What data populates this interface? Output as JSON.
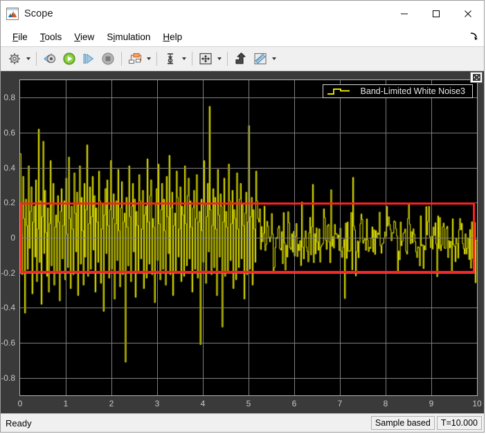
{
  "window": {
    "title": "Scope",
    "app_icon": "matlab-membrane-icon",
    "controls": [
      {
        "name": "minimize-button",
        "glyph": "minimize-icon"
      },
      {
        "name": "maximize-button",
        "glyph": "maximize-icon"
      },
      {
        "name": "close-button",
        "glyph": "close-icon"
      }
    ]
  },
  "menubar": {
    "items": [
      {
        "label": "File",
        "mnemonic": "F"
      },
      {
        "label": "Tools",
        "mnemonic": "T"
      },
      {
        "label": "View",
        "mnemonic": "V"
      },
      {
        "label": "Simulation",
        "mnemonic": "i"
      },
      {
        "label": "Help",
        "mnemonic": "H"
      }
    ],
    "corner_icon": "undock-arrow-icon"
  },
  "toolbar": {
    "buttons": [
      {
        "name": "configuration-properties-button",
        "icon": "gear-icon",
        "has_caret": true
      },
      {
        "name": "sim-rewind-button",
        "icon": "rewind-icon",
        "has_caret": false
      },
      {
        "name": "run-button",
        "icon": "play-icon",
        "has_caret": false
      },
      {
        "name": "step-forward-button",
        "icon": "step-forward-icon",
        "has_caret": false
      },
      {
        "name": "stop-button",
        "icon": "stop-icon",
        "has_caret": false
      },
      {
        "name": "signal-selection-button",
        "icon": "signal-blocks-icon",
        "has_caret": true
      },
      {
        "name": "cursor-measurements-button",
        "icon": "cursor-icon",
        "has_caret": true
      },
      {
        "name": "scale-axes-limits-button",
        "icon": "fit-to-view-icon",
        "has_caret": true
      },
      {
        "name": "highlight-signal-button",
        "icon": "highlight-arrow-icon",
        "has_caret": false
      },
      {
        "name": "measurements-button",
        "icon": "ruler-icon",
        "has_caret": true
      }
    ]
  },
  "plot": {
    "fit_button_icon": "expand-icon",
    "legend": {
      "label": "Band-Limited White Noise3",
      "glyph": "yellow-step-line-icon",
      "color": "#ffff00"
    },
    "bound_rect": {
      "color": "#ff2020",
      "y_top": 0.2,
      "y_bottom": -0.2,
      "x_left": 0.0,
      "x_right": 9.95
    }
  },
  "statusbar": {
    "ready_text": "Ready",
    "sample_mode": "Sample based",
    "time": "T=10.000"
  },
  "chart_data": {
    "type": "line",
    "title": "",
    "xlabel": "",
    "ylabel": "",
    "xlim": [
      0,
      10
    ],
    "ylim": [
      -0.9,
      0.9
    ],
    "xticks": [
      0,
      1,
      2,
      3,
      4,
      5,
      6,
      7,
      8,
      9,
      10
    ],
    "yticks": [
      -0.8,
      -0.6,
      -0.4,
      -0.2,
      0,
      0.2,
      0.4,
      0.6,
      0.8
    ],
    "ytick_labels": [
      "-0.8",
      "-0.6",
      "-0.4",
      "-0.2",
      "0",
      "0.2",
      "0.4",
      "0.6",
      "0.8"
    ],
    "xtick_labels": [
      "0",
      "1",
      "2",
      "3",
      "4",
      "5",
      "6",
      "7",
      "8",
      "9",
      "10"
    ],
    "grid": true,
    "background": "#000000",
    "grid_color": "#808080",
    "legend_position": "top-right",
    "series": [
      {
        "name": "Band-Limited White Noise3",
        "color": "#ffff00",
        "style": "stairs",
        "sample_count": 500,
        "x_start": 0,
        "x_end": 10,
        "description": "Band-limited white noise, sample-based, mean 0, values mostly within +/-0.25 with occasional excursions to +/-0.75",
        "values": [
          0.48,
          0.02,
          -0.21,
          0.35,
          0.11,
          -0.43,
          0.22,
          0.07,
          -0.18,
          0.41,
          -0.06,
          0.15,
          0.29,
          -0.32,
          0.09,
          0.18,
          -0.11,
          0.33,
          -0.25,
          0.05,
          0.62,
          -0.14,
          0.21,
          -0.38,
          0.12,
          0.55,
          -0.09,
          0.27,
          0.03,
          -0.22,
          0.17,
          -0.31,
          0.08,
          0.44,
          -0.16,
          0.19,
          0.31,
          -0.27,
          0.06,
          0.13,
          -0.19,
          0.24,
          0.09,
          -0.36,
          0.15,
          0.28,
          -0.12,
          0.07,
          0.21,
          -0.24,
          0.34,
          0.02,
          -0.17,
          0.46,
          0.11,
          -0.29,
          0.18,
          0.05,
          -0.21,
          0.37,
          0.14,
          -0.08,
          0.26,
          -0.33,
          0.19,
          0.41,
          -0.15,
          0.23,
          0.04,
          -0.27,
          0.31,
          -0.11,
          0.16,
          0.53,
          -0.22,
          0.08,
          0.29,
          -0.18,
          0.12,
          0.35,
          -0.07,
          0.24,
          -0.31,
          0.17,
          0.09,
          -0.14,
          0.38,
          0.21,
          -0.26,
          0.05,
          0.19,
          -0.42,
          0.13,
          0.28,
          -0.09,
          0.33,
          0.07,
          -0.23,
          0.16,
          0.44,
          -0.18,
          0.11,
          0.25,
          -0.35,
          0.08,
          0.21,
          -0.13,
          0.39,
          0.04,
          -0.28,
          0.17,
          0.32,
          -0.21,
          0.09,
          0.14,
          -0.71,
          0.23,
          0.06,
          -0.16,
          0.41,
          0.12,
          -0.25,
          0.18,
          0.31,
          -0.08,
          0.22,
          -0.34,
          0.15,
          0.07,
          -0.19,
          0.36,
          0.21,
          -0.12,
          0.05,
          0.27,
          -0.29,
          0.13,
          0.18,
          -0.23,
          0.45,
          0.09,
          -0.15,
          0.24,
          0.33,
          -0.21,
          0.11,
          0.06,
          -0.37,
          0.19,
          0.28,
          -0.13,
          0.42,
          0.08,
          -0.24,
          0.16,
          0.31,
          -0.18,
          0.22,
          0.04,
          -0.27,
          0.35,
          0.12,
          -0.09,
          0.47,
          -0.21,
          0.17,
          0.26,
          -0.33,
          0.07,
          0.14,
          -0.19,
          0.38,
          0.23,
          -0.11,
          0.05,
          0.29,
          -0.25,
          0.18,
          0.13,
          -0.22,
          0.41,
          0.08,
          -0.16,
          0.24,
          0.34,
          -0.12,
          0.21,
          0.06,
          -0.31,
          0.17,
          0.27,
          -0.18,
          0.11,
          0.36,
          -0.23,
          0.09,
          0.15,
          -0.61,
          0.22,
          0.04,
          -0.14,
          0.44,
          0.19,
          -0.26,
          0.12,
          0.31,
          -0.08,
          0.75,
          0.16,
          -0.21,
          0.07,
          0.28,
          -0.17,
          0.23,
          0.05,
          -0.33,
          0.39,
          0.13,
          -0.11,
          0.25,
          0.18,
          -0.51,
          0.09,
          0.34,
          -0.22,
          0.15,
          0.06,
          -0.19,
          0.42,
          0.21,
          -0.13,
          0.08,
          0.27,
          -0.29,
          0.16,
          0.11,
          -0.24,
          0.37,
          0.05,
          -0.17,
          0.22,
          0.31,
          -0.12,
          0.19,
          0.07,
          -0.35,
          0.14,
          0.26,
          -0.21,
          0.09,
          0.64,
          -0.18,
          0.12,
          0.23,
          -0.27,
          0.16,
          0.05,
          -0.14,
          0.38,
          0.21
        ]
      }
    ]
  }
}
